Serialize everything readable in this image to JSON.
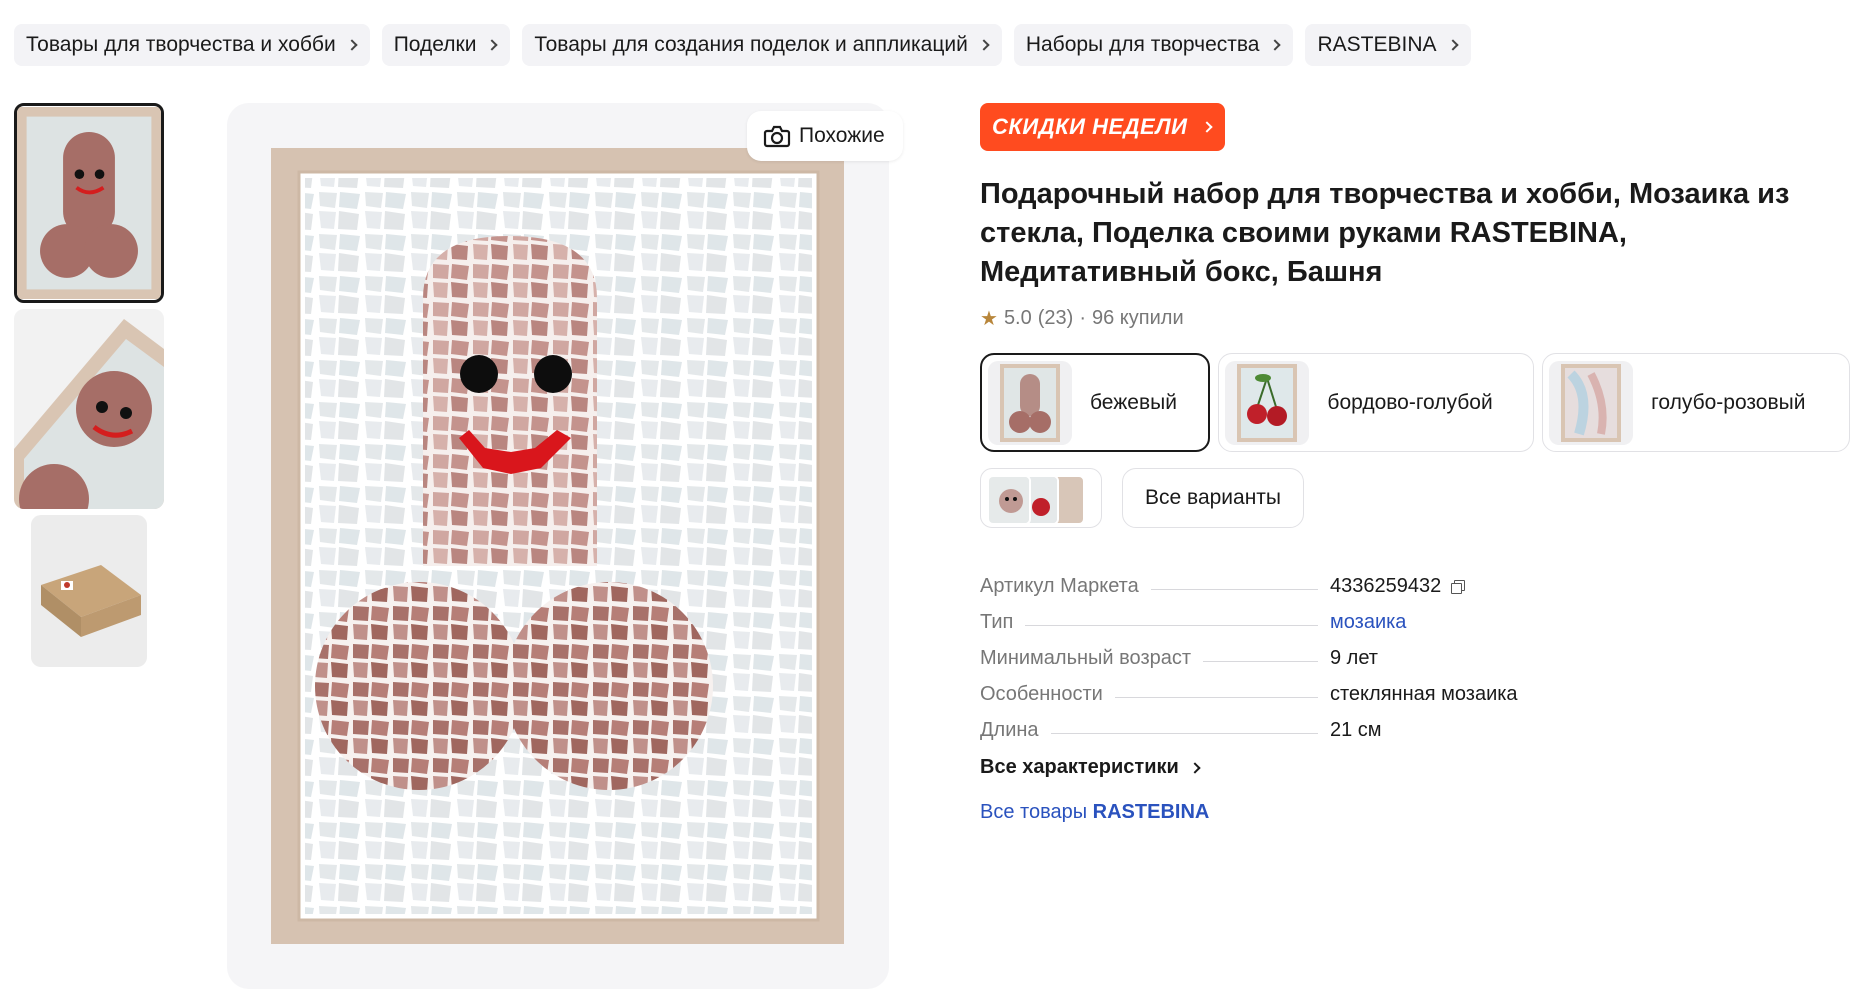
{
  "breadcrumbs": [
    {
      "label": "Товары для творчества и хобби"
    },
    {
      "label": "Поделки"
    },
    {
      "label": "Товары для создания поделок и аппликаций"
    },
    {
      "label": "Наборы для творчества"
    },
    {
      "label": "RASTEBINA"
    }
  ],
  "gallery": {
    "similar_label": "Похожие",
    "thumbnail_count": 3
  },
  "promo": {
    "label": "СКИДКИ НЕДЕЛИ"
  },
  "product": {
    "title": "Подарочный набор для творчества и хобби, Мозаика из стекла, Поделка своими руками RASTEBINA, Медитативный бокс, Башня",
    "rating": "5.0",
    "reviews": "(23)",
    "separator": "·",
    "bought": "96 купили"
  },
  "variants": [
    {
      "label": "бежевый",
      "selected": true
    },
    {
      "label": "бордово-голубой",
      "selected": false
    },
    {
      "label": "голубо-розовый",
      "selected": false
    }
  ],
  "all_variants_label": "Все варианты",
  "specs": [
    {
      "key": "Артикул Маркета",
      "value": "4336259432",
      "copyable": true
    },
    {
      "key": "Тип",
      "value": "мозаика",
      "link": true
    },
    {
      "key": "Минимальный возраст",
      "value": "9 лет"
    },
    {
      "key": "Особенности",
      "value": "стеклянная мозаика"
    },
    {
      "key": "Длина",
      "value": "21 см"
    }
  ],
  "all_characteristics_label": "Все характеристики",
  "brand_link": {
    "prefix": "Все товары",
    "brand": "RASTEBINA"
  },
  "colors": {
    "promo": "#ff4b1f",
    "link": "#2a52be",
    "chip_bg": "#f3f3f6",
    "star": "#b8863b"
  }
}
